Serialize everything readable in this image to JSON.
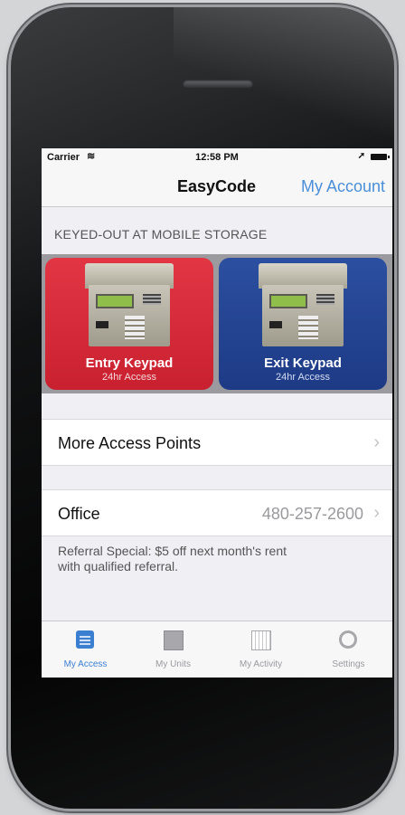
{
  "status_bar": {
    "carrier": "Carrier",
    "time": "12:58 PM"
  },
  "nav": {
    "title": "EasyCode",
    "right_action": "My Account"
  },
  "section_header": "KEYED-OUT AT MOBILE STORAGE",
  "keypads": [
    {
      "title": "Entry Keypad",
      "subtitle": "24hr Access",
      "color": "#d62b3a"
    },
    {
      "title": "Exit Keypad",
      "subtitle": "24hr Access",
      "color": "#24458f"
    }
  ],
  "more_access": {
    "label": "More Access Points"
  },
  "office": {
    "label": "Office",
    "phone": "480-257-2600"
  },
  "referral": {
    "line1": "Referral Special: $5 off next month's rent",
    "line2": "with qualified referral."
  },
  "tabs": [
    {
      "label": "My Access",
      "icon": "keypad-icon",
      "active": true
    },
    {
      "label": "My Units",
      "icon": "unit-icon",
      "active": false
    },
    {
      "label": "My Activity",
      "icon": "calendar-icon",
      "active": false
    },
    {
      "label": "Settings",
      "icon": "gear-icon",
      "active": false
    }
  ],
  "colors": {
    "accent": "#3b7fd1",
    "entry": "#d62b3a",
    "exit": "#24458f"
  }
}
